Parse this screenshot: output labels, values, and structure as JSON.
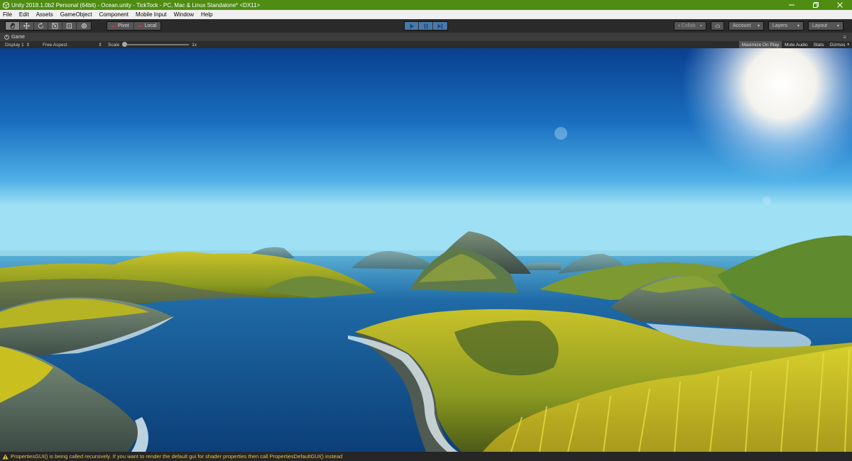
{
  "window": {
    "title": "Unity 2018.1.0b2 Personal (64bit) - Ocean.unity - TickTock - PC, Mac & Linux Standalone* <DX11>",
    "buttons": [
      "minimize",
      "maximize",
      "close"
    ]
  },
  "menu": [
    "File",
    "Edit",
    "Assets",
    "GameObject",
    "Component",
    "Mobile Input",
    "Window",
    "Help"
  ],
  "toolbar": {
    "tools": [
      "hand-icon",
      "move-icon",
      "rotate-icon",
      "scale-icon",
      "rect-icon",
      "transform-icon"
    ],
    "pivot_label": "Pivot",
    "local_label": "Local",
    "collab_label": "Collab",
    "account_label": "Account",
    "layers_label": "Layers",
    "layout_label": "Layout"
  },
  "game_tab": {
    "label": "Game",
    "display": "Display 1",
    "aspect": "Free Aspect",
    "scale_label": "Scale",
    "scale_value": "1x",
    "maximize_on_play": "Maximize On Play",
    "mute_audio": "Mute Audio",
    "stats": "Stats",
    "gizmos": "Gizmos"
  },
  "status": {
    "message": "PropertiesGUI() is being called recursively. If you want to render the default gui for shader properties then call PropertiesDefaultGUI() instead"
  },
  "colors": {
    "titlebar": "#4e8c12",
    "warning": "#e0c34a",
    "play_active": "#4a78a8"
  }
}
